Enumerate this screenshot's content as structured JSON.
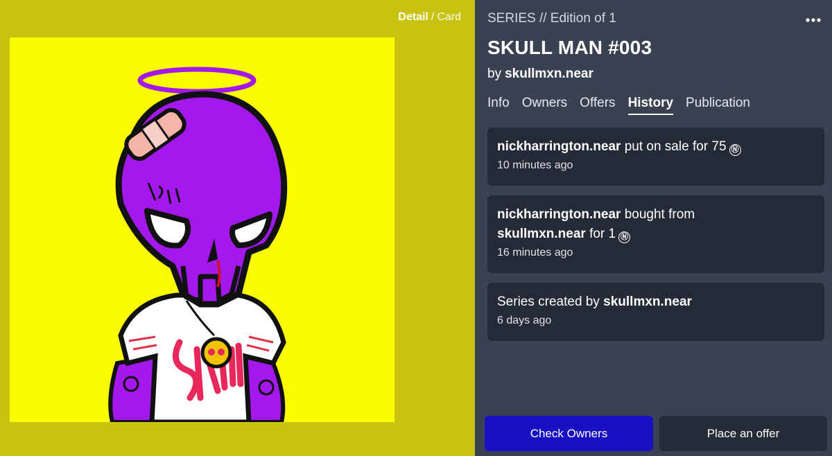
{
  "view_toggle": {
    "active": "Detail",
    "separator": "/",
    "inactive": "Card"
  },
  "header": {
    "series_line": "SERIES // Edition of 1",
    "title": "SKULL MAN #003",
    "by_label": "by",
    "creator": "skullmxn.near"
  },
  "tabs": [
    {
      "label": "Info",
      "active": false
    },
    {
      "label": "Owners",
      "active": false
    },
    {
      "label": "Offers",
      "active": false
    },
    {
      "label": "History",
      "active": true
    },
    {
      "label": "Publication",
      "active": false
    }
  ],
  "history": [
    {
      "user": "nickharrington.near",
      "action": "put on sale for 75",
      "currency_icon": "near-icon",
      "currency_symbol": "Ⓝ",
      "time": "10 minutes ago"
    },
    {
      "user": "nickharrington.near",
      "action": "bought from",
      "counterparty": "skullmxn.near",
      "price_text": "for 1",
      "currency_icon": "near-icon",
      "currency_symbol": "Ⓝ",
      "time": "16 minutes ago"
    },
    {
      "prefix": "Series created by",
      "user": "skullmxn.near",
      "time": "6 days ago"
    }
  ],
  "buttons": {
    "check_owners": "Check Owners",
    "place_offer": "Place an offer"
  },
  "colors": {
    "left_background": "#c8c30e",
    "artwork_background": "#fafb00",
    "panel_background": "#3a4252",
    "card_background": "#242a36",
    "primary_button": "#1810c2",
    "skull_purple": "#a318ea"
  }
}
